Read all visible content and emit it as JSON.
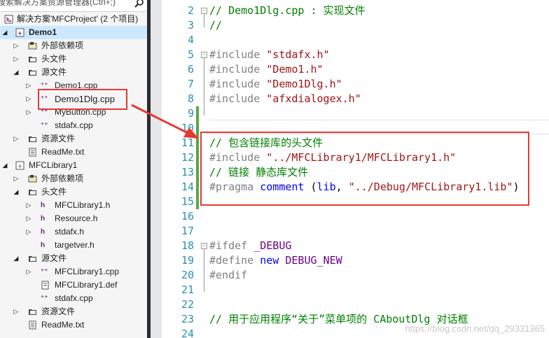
{
  "explorer": {
    "search_placeholder": "搜索解决方案资源管理器(Ctrl+;)",
    "rows": [
      {
        "label": "解决方案'MFCProject' (2 个项目)",
        "icon": "solution-icon"
      },
      {
        "label": "Demo1",
        "icon": "project-icon"
      },
      {
        "label": "外部依赖项",
        "icon": "references-icon"
      },
      {
        "label": "头文件",
        "icon": "folder-icon"
      },
      {
        "label": "源文件",
        "icon": "folder-icon"
      },
      {
        "label": "Demo1.cpp",
        "icon": "cpp-file-icon"
      },
      {
        "label": "Demo1Dlg.cpp",
        "icon": "cpp-file-icon"
      },
      {
        "label": "MyButton.cpp",
        "icon": "cpp-file-icon"
      },
      {
        "label": "stdafx.cpp",
        "icon": "cpp-file-icon"
      },
      {
        "label": "资源文件",
        "icon": "folder-icon"
      },
      {
        "label": "ReadMe.txt",
        "icon": "text-file-icon"
      },
      {
        "label": "MFCLibrary1",
        "icon": "project-icon"
      },
      {
        "label": "外部依赖项",
        "icon": "references-icon"
      },
      {
        "label": "头文件",
        "icon": "folder-icon"
      },
      {
        "label": "MFCLibrary1.h",
        "icon": "header-file-icon"
      },
      {
        "label": "Resource.h",
        "icon": "header-file-icon"
      },
      {
        "label": "stdafx.h",
        "icon": "header-file-icon"
      },
      {
        "label": "targetver.h",
        "icon": "header-file-icon"
      },
      {
        "label": "源文件",
        "icon": "folder-icon"
      },
      {
        "label": "MFCLibrary1.cpp",
        "icon": "cpp-file-icon"
      },
      {
        "label": "MFCLibrary1.def",
        "icon": "def-file-icon"
      },
      {
        "label": "stdafx.cpp",
        "icon": "cpp-file-icon"
      },
      {
        "label": "资源文件",
        "icon": "folder-icon"
      },
      {
        "label": "ReadMe.txt",
        "icon": "text-file-icon"
      }
    ]
  },
  "editor": {
    "lines": [
      {
        "num": "2",
        "tokens": [
          {
            "t": "// Demo1Dlg.cpp : 实现文件",
            "c": "cmt"
          }
        ]
      },
      {
        "num": "3",
        "tokens": [
          {
            "t": "//",
            "c": "cmt"
          }
        ]
      },
      {
        "num": "4",
        "tokens": []
      },
      {
        "num": "5",
        "tokens": [
          {
            "t": "#include",
            "c": "kw-pre"
          },
          {
            "t": " ",
            "c": ""
          },
          {
            "t": "\"stdafx.h\"",
            "c": "str"
          }
        ]
      },
      {
        "num": "6",
        "tokens": [
          {
            "t": "#include",
            "c": "kw-pre"
          },
          {
            "t": " ",
            "c": ""
          },
          {
            "t": "\"Demo1.h\"",
            "c": "str"
          }
        ]
      },
      {
        "num": "7",
        "tokens": [
          {
            "t": "#include",
            "c": "kw-pre"
          },
          {
            "t": " ",
            "c": ""
          },
          {
            "t": "\"Demo1Dlg.h\"",
            "c": "str"
          }
        ]
      },
      {
        "num": "8",
        "tokens": [
          {
            "t": "#include",
            "c": "kw-pre"
          },
          {
            "t": " ",
            "c": ""
          },
          {
            "t": "\"afxdialogex.h\"",
            "c": "str"
          }
        ]
      },
      {
        "num": "9",
        "tokens": []
      },
      {
        "num": "10",
        "tokens": []
      },
      {
        "num": "11",
        "tokens": [
          {
            "t": "// 包含链接库的头文件",
            "c": "cmt"
          }
        ]
      },
      {
        "num": "12",
        "tokens": [
          {
            "t": "#include",
            "c": "kw-pre"
          },
          {
            "t": " ",
            "c": ""
          },
          {
            "t": "\"../MFCLibrary1/MFCLibrary1.h\"",
            "c": "str"
          }
        ]
      },
      {
        "num": "13",
        "tokens": [
          {
            "t": "// 链接 静态库文件",
            "c": "cmt"
          }
        ]
      },
      {
        "num": "14",
        "tokens": [
          {
            "t": "#pragma",
            "c": "kw-pre"
          },
          {
            "t": " ",
            "c": ""
          },
          {
            "t": "comment",
            "c": "kw"
          },
          {
            "t": " (",
            "c": ""
          },
          {
            "t": "lib",
            "c": "kw"
          },
          {
            "t": ", ",
            "c": ""
          },
          {
            "t": "\"../Debug/MFCLibrary1.lib\"",
            "c": "str"
          },
          {
            "t": ")",
            "c": ""
          }
        ]
      },
      {
        "num": "15",
        "tokens": []
      },
      {
        "num": "16",
        "tokens": []
      },
      {
        "num": "17",
        "tokens": []
      },
      {
        "num": "18",
        "tokens": [
          {
            "t": "#ifdef",
            "c": "kw-pre"
          },
          {
            "t": " ",
            "c": ""
          },
          {
            "t": "_DEBUG",
            "c": "mac"
          }
        ]
      },
      {
        "num": "19",
        "tokens": [
          {
            "t": "#define",
            "c": "kw-pre"
          },
          {
            "t": " ",
            "c": ""
          },
          {
            "t": "new",
            "c": "kw"
          },
          {
            "t": " ",
            "c": ""
          },
          {
            "t": "DEBUG_NEW",
            "c": "mac"
          }
        ]
      },
      {
        "num": "20",
        "tokens": [
          {
            "t": "#endif",
            "c": "kw-pre"
          }
        ]
      },
      {
        "num": "21",
        "tokens": []
      },
      {
        "num": "22",
        "tokens": []
      },
      {
        "num": "23",
        "tokens": [
          {
            "t": "// 用于应用程序“关于”菜单项的 CAboutDlg 对话框",
            "c": "cmt"
          }
        ]
      },
      {
        "num": "24",
        "tokens": []
      }
    ]
  },
  "watermark": "https://blog.csdn.net/qq_29331365",
  "colors": {
    "annotation_red": "#e53935",
    "line_number": "#2b91af",
    "comment": "#008000",
    "string": "#a31515"
  }
}
